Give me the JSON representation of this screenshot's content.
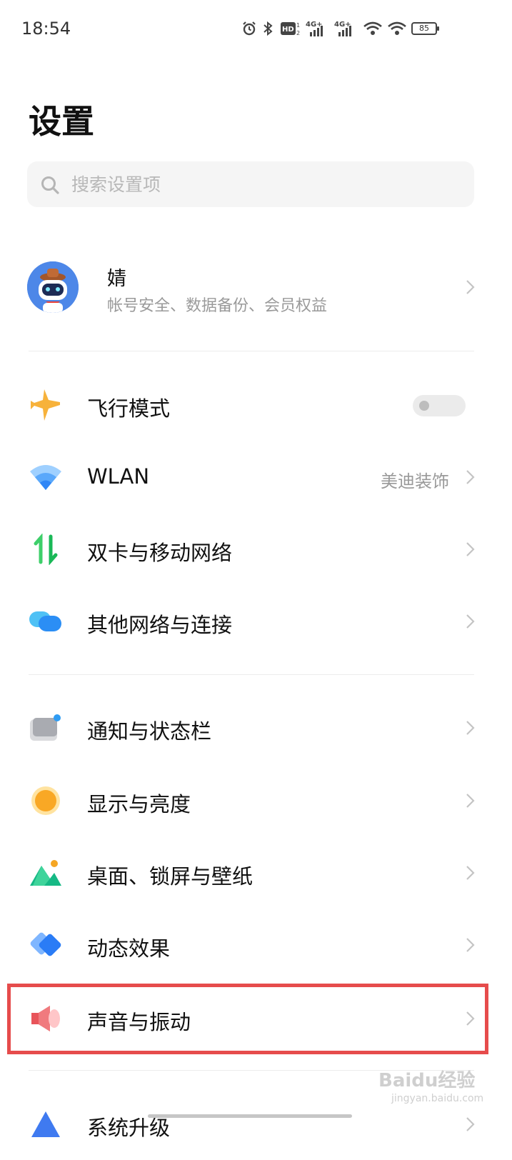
{
  "status_bar": {
    "time": "18:54",
    "battery": "85",
    "network_labels": [
      "4G+",
      "4G+"
    ]
  },
  "page_title": "设置",
  "search": {
    "placeholder": "搜索设置项",
    "value": ""
  },
  "account": {
    "name": "婧",
    "subtitle": "帐号安全、数据备份、会员权益"
  },
  "rows": {
    "airplane": {
      "label": "飞行模式",
      "toggle_on": false
    },
    "wlan": {
      "label": "WLAN",
      "value": "美迪装饰"
    },
    "dual_sim": {
      "label": "双卡与移动网络"
    },
    "other_network": {
      "label": "其他网络与连接"
    },
    "notification": {
      "label": "通知与状态栏"
    },
    "display": {
      "label": "显示与亮度"
    },
    "desktop": {
      "label": "桌面、锁屏与壁纸"
    },
    "animation": {
      "label": "动态效果"
    },
    "sound": {
      "label": "声音与振动",
      "highlighted": true
    },
    "system_update": {
      "label": "系统升级"
    }
  },
  "watermark": {
    "text": "Baidu经验",
    "sub": "jingyan.baidu.com"
  },
  "colors": {
    "highlight_border": "#e64c4c",
    "airplane": "#f7b23b",
    "wifi": "#2f86f6",
    "dual_sim": "#3ecf6a",
    "sound": "#e8545a"
  }
}
